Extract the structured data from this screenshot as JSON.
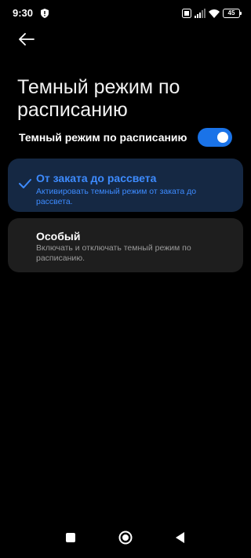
{
  "status_bar": {
    "time": "9:30",
    "battery": "45"
  },
  "header": {
    "title": "Темный режим по расписанию"
  },
  "schedule_toggle": {
    "label": "Темный режим по расписанию",
    "enabled": true
  },
  "options": [
    {
      "title": "От заката до рассвета",
      "description": "Активировать темный режим от заката до рассвета.",
      "selected": true
    },
    {
      "title": "Особый",
      "description": "Включать и отключать темный режим по расписанию.",
      "selected": false
    }
  ],
  "colors": {
    "accent": "#1a73e8",
    "selected_text": "#3d8bff",
    "selected_card": "#152843",
    "card": "#1e1e1e",
    "background": "#000000"
  },
  "icons": {
    "back": "arrow-left-icon",
    "check": "check-icon",
    "recents": "square-icon",
    "home": "circle-icon",
    "nav_back": "triangle-icon"
  }
}
